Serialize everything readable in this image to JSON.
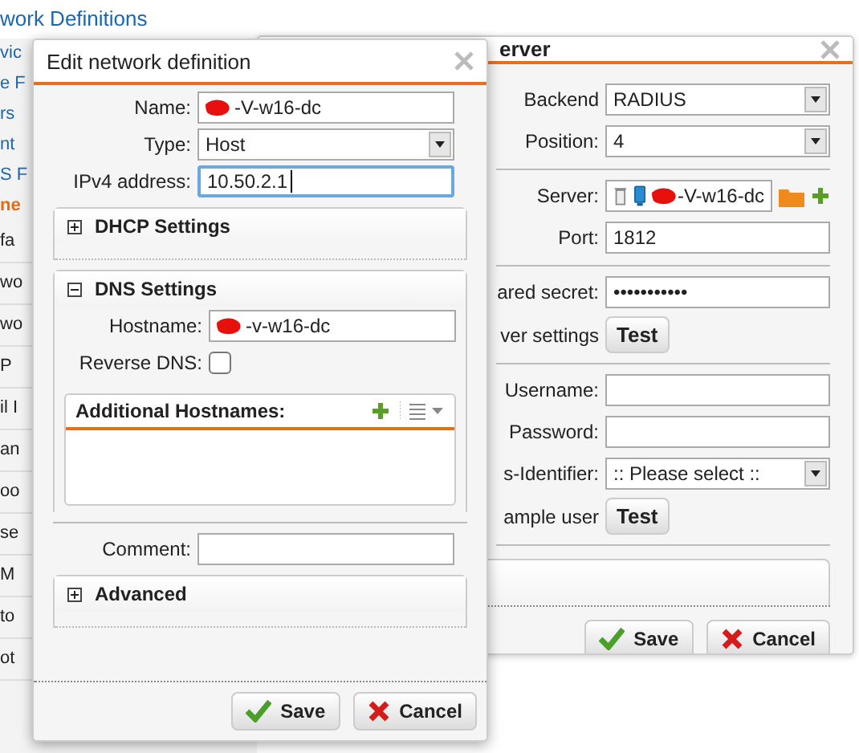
{
  "background_list": {
    "heading": "work Definitions",
    "items": [
      {
        "label": "vic",
        "kind": "link",
        "selected": false
      },
      {
        "label": "e F",
        "kind": "link",
        "selected": false
      },
      {
        "label": "rs",
        "kind": "link",
        "selected": false
      },
      {
        "label": "nt",
        "kind": "link",
        "selected": false
      },
      {
        "label": "S F",
        "kind": "link",
        "selected": false
      },
      {
        "label": "ne",
        "kind": "link",
        "selected": true
      },
      {
        "label": "fa",
        "kind": "plain",
        "selected": false
      },
      {
        "label": "wo",
        "kind": "plain",
        "selected": false
      },
      {
        "label": "wo",
        "kind": "plain",
        "selected": false
      },
      {
        "label": "P",
        "kind": "plain",
        "selected": false
      },
      {
        "label": "il I",
        "kind": "plain",
        "selected": false
      },
      {
        "label": "an",
        "kind": "plain",
        "selected": false
      },
      {
        "label": "oo",
        "kind": "plain",
        "selected": false
      },
      {
        "label": "se",
        "kind": "plain",
        "selected": false
      },
      {
        "label": "M",
        "kind": "plain",
        "selected": false
      },
      {
        "label": "to",
        "kind": "plain",
        "selected": false
      },
      {
        "label": "ot",
        "kind": "plain",
        "selected": false
      }
    ]
  },
  "server_dialog": {
    "title": "erver",
    "sections": [
      [
        {
          "kind": "select",
          "label": "Backend",
          "value": "RADIUS"
        },
        {
          "kind": "select",
          "label": "Position:",
          "value": "4"
        }
      ],
      [
        {
          "kind": "server",
          "label": "Server:",
          "value": "-V-w16-dc",
          "redacted": true
        },
        {
          "kind": "text",
          "label": "Port:",
          "value": "1812"
        }
      ],
      [
        {
          "kind": "text",
          "label": "ared secret:",
          "value": "•••••••••••"
        },
        {
          "kind": "button",
          "label": "ver settings",
          "button": "Test"
        }
      ],
      [
        {
          "kind": "text",
          "label": "Username:"
        },
        {
          "kind": "text",
          "label": "Password:"
        },
        {
          "kind": "select",
          "label": "s-Identifier:",
          "value": ":: Please select ::"
        },
        {
          "kind": "button",
          "label": "ample user",
          "button": "Test"
        }
      ]
    ],
    "buttons": [
      {
        "label": "Save",
        "kind": "save"
      },
      {
        "label": "Cancel",
        "kind": "cancel"
      }
    ]
  },
  "network_dialog": {
    "title": "Edit network definition",
    "content": [
      {
        "kind": "fields",
        "fields": [
          {
            "kind": "text",
            "label": "Name:",
            "value": "-V-w16-dc",
            "redacted": true
          },
          {
            "kind": "select",
            "label": "Type:",
            "value": "Host"
          },
          {
            "kind": "text",
            "label": "IPv4 address:",
            "value": "10.50.2.1",
            "focused": true
          }
        ]
      },
      {
        "kind": "panel",
        "title": "DHCP Settings",
        "expanded": false
      },
      {
        "kind": "panel",
        "title": "DNS Settings",
        "expanded": true,
        "fields": [
          {
            "kind": "text",
            "label": "Hostname:",
            "value": "-v-w16-dc",
            "redacted": true
          },
          {
            "kind": "checkbox",
            "label": "Reverse DNS:",
            "checked": false
          }
        ],
        "grid": {
          "title": "Additional Hostnames:"
        }
      },
      {
        "kind": "fields",
        "fields": [
          {
            "kind": "text",
            "label": "Comment:"
          }
        ]
      },
      {
        "kind": "panel",
        "title": "Advanced",
        "expanded": false
      }
    ],
    "buttons": [
      {
        "label": "Save",
        "kind": "save"
      },
      {
        "label": "Cancel",
        "kind": "cancel"
      }
    ]
  }
}
